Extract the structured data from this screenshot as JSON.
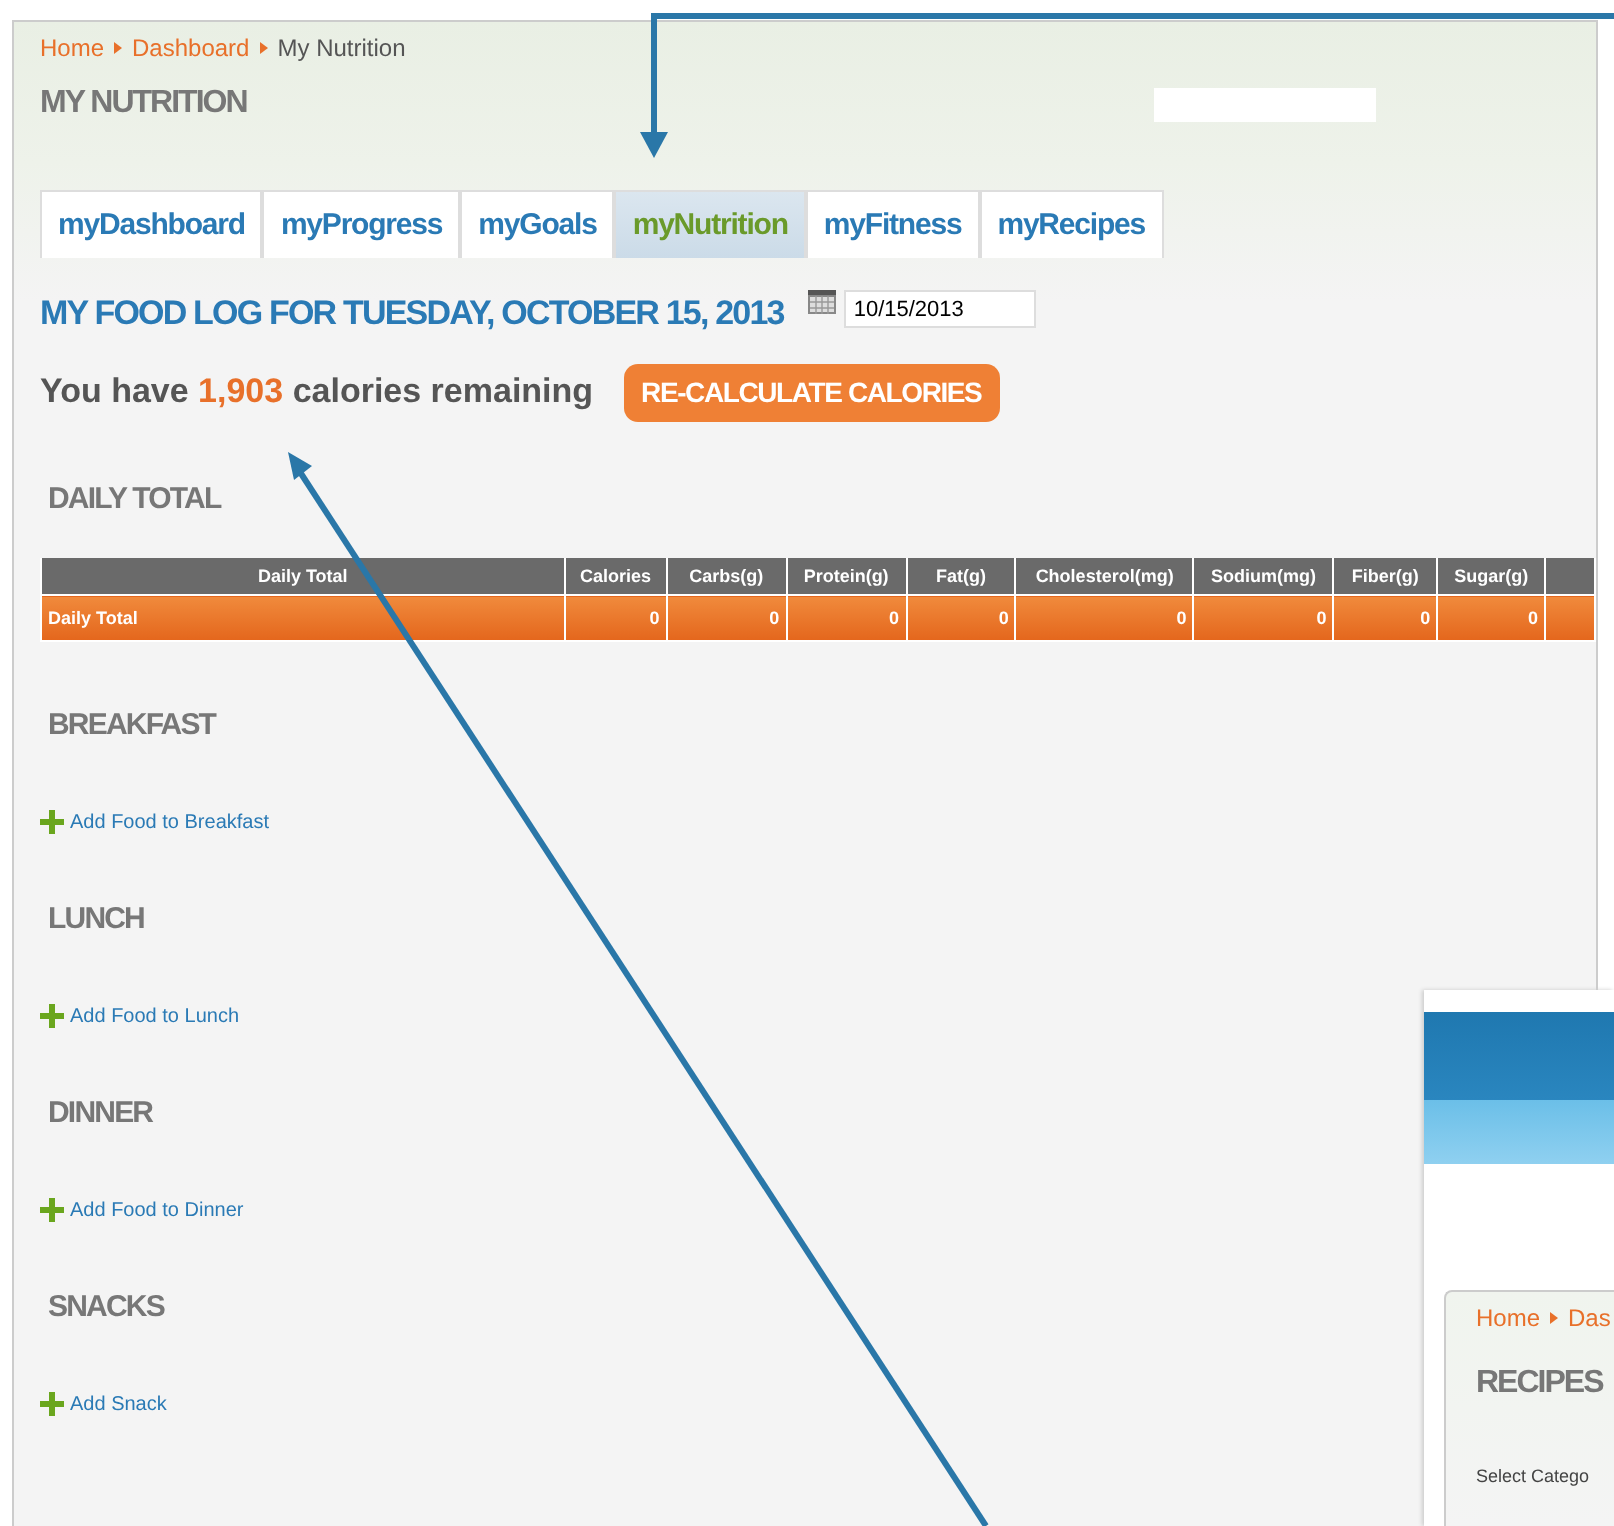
{
  "breadcrumb": [
    {
      "label": "Home",
      "current": false
    },
    {
      "label": "Dashboard",
      "current": false
    },
    {
      "label": "My Nutrition",
      "current": true
    }
  ],
  "page_title": "MY NUTRITION",
  "tabs": [
    {
      "label": "myDashboard",
      "selected": false
    },
    {
      "label": "myProgress",
      "selected": false
    },
    {
      "label": "myGoals",
      "selected": false
    },
    {
      "label": "myNutrition",
      "selected": true
    },
    {
      "label": "myFitness",
      "selected": false
    },
    {
      "label": "myRecipes",
      "selected": false
    }
  ],
  "food_log": {
    "title": "MY FOOD LOG FOR TUESDAY, OCTOBER 15, 2013",
    "date": "10/15/2013"
  },
  "calories": {
    "prefix": "You have",
    "count": "1,903",
    "suffix": "calories remaining",
    "button": "RE-CALCULATE CALORIES"
  },
  "daily_total": {
    "heading": "DAILY TOTAL",
    "columns": [
      "Daily Total",
      "Calories",
      "Carbs(g)",
      "Protein(g)",
      "Fat(g)",
      "Cholesterol(mg)",
      "Sodium(mg)",
      "Fiber(g)",
      "Sugar(g)"
    ],
    "rows": [
      [
        "Daily Total",
        "0",
        "0",
        "0",
        "0",
        "0",
        "0",
        "0",
        "0"
      ]
    ]
  },
  "meals": [
    {
      "heading": "BREAKFAST",
      "link": "Add Food to Breakfast"
    },
    {
      "heading": "LUNCH",
      "link": "Add Food to Lunch"
    },
    {
      "heading": "DINNER",
      "link": "Add Food to Dinner"
    },
    {
      "heading": "SNACKS",
      "link": "Add Snack"
    }
  ],
  "inset": {
    "breadcrumb": [
      "Home",
      "Das"
    ],
    "title": "RECIPES",
    "label": "Select Catego"
  }
}
